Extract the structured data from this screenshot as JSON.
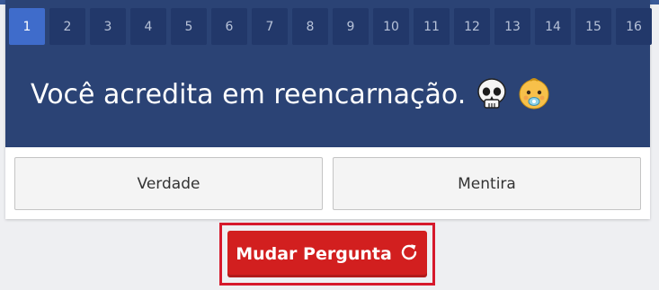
{
  "tabs": [
    {
      "label": "1",
      "active": true
    },
    {
      "label": "2",
      "active": false
    },
    {
      "label": "3",
      "active": false
    },
    {
      "label": "4",
      "active": false
    },
    {
      "label": "5",
      "active": false
    },
    {
      "label": "6",
      "active": false
    },
    {
      "label": "7",
      "active": false
    },
    {
      "label": "8",
      "active": false
    },
    {
      "label": "9",
      "active": false
    },
    {
      "label": "10",
      "active": false
    },
    {
      "label": "11",
      "active": false
    },
    {
      "label": "12",
      "active": false
    },
    {
      "label": "13",
      "active": false
    },
    {
      "label": "14",
      "active": false
    },
    {
      "label": "15",
      "active": false
    },
    {
      "label": "16",
      "active": false
    }
  ],
  "question": {
    "text": "Você acredita em reencarnação.",
    "icons": [
      "skull-icon",
      "baby-icon"
    ]
  },
  "answers": {
    "true_label": "Verdade",
    "false_label": "Mentira"
  },
  "change_button": {
    "label": "Mudar Pergunta",
    "icon": "refresh-icon"
  },
  "colors": {
    "header": "#2b4375",
    "tab_active": "#3f6ccb",
    "tab": "#22386a",
    "accent_red": "#d21f1f"
  }
}
